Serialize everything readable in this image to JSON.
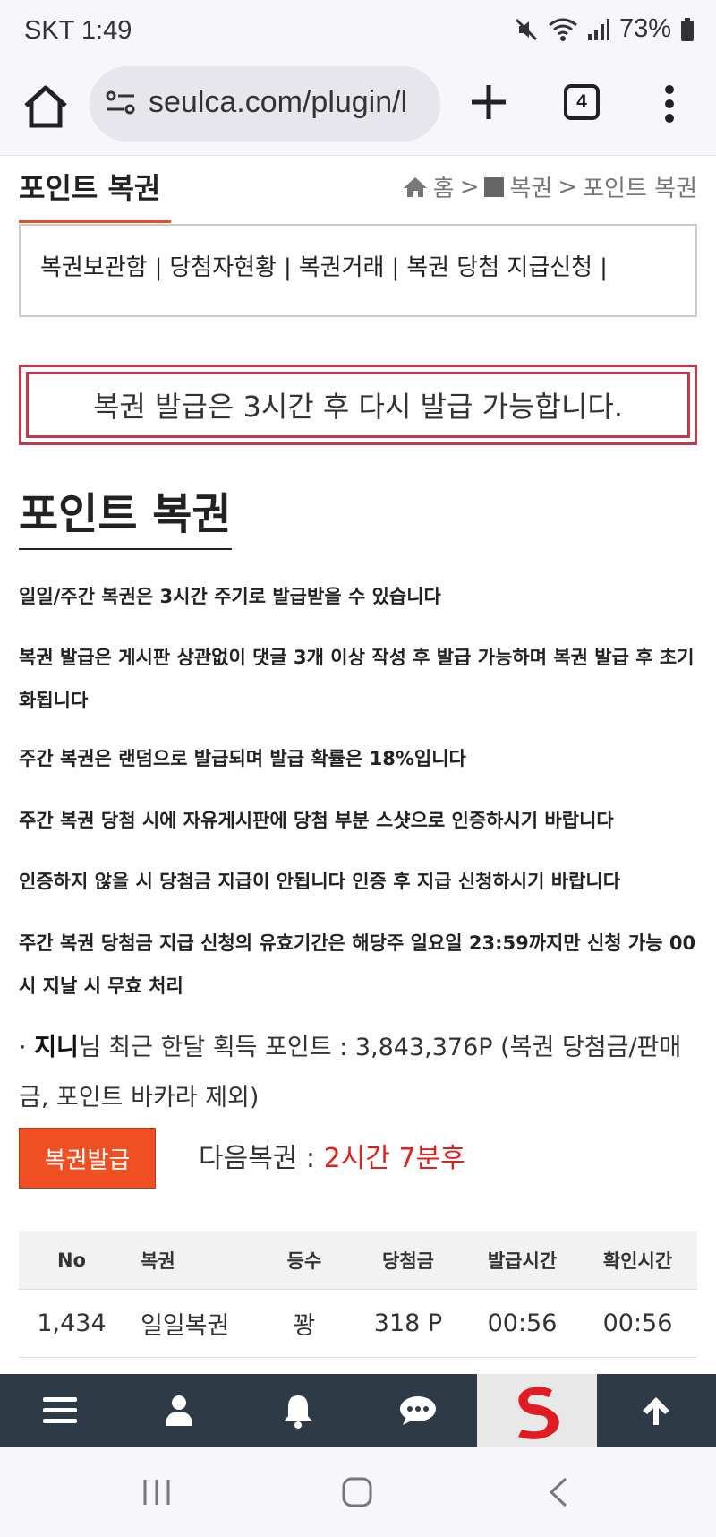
{
  "status_bar": {
    "time": "SKT 1:49",
    "battery": "73%"
  },
  "browser": {
    "url": "seulca.com/plugin/l",
    "tab_count": "4"
  },
  "page": {
    "title": "포인트 복권",
    "breadcrumb": {
      "home": "홈",
      "sep1": ">",
      "section": "복권",
      "sep2": ">",
      "current": "포인트 복권"
    },
    "menu": [
      "복권보관함",
      "당첨자현황",
      "복권거래",
      "복권 당첨 지급신청"
    ],
    "menu_sep": "|",
    "notice": "복권 발급은 3시간 후 다시 발급 가능합니다.",
    "section_title": "포인트 복권",
    "rules": [
      "일일/주간 복권은 3시간 주기로 발급받을 수 있습니다",
      "복권 발급은 게시판 상관없이 댓글 3개 이상 작성 후 발급 가능하며 복권 발급 후 초기화됩니다",
      "주간 복권은 랜덤으로 발급되며 발급 확률은 18%입니다",
      "주간 복권 당첨 시에 자유게시판에 당첨 부분 스샷으로 인증하시기 바랍니다",
      "인증하지 않을 시 당첨금 지급이 안됩니다 인증 후 지급 신청하시기 바랍니다",
      "주간 복권 당첨금 지급 신청의 유효기간은 해당주 일요일 23:59까지만 신청 가능 00시 지날 시 무효 처리"
    ],
    "points": {
      "bullet": "·",
      "user": "지니",
      "text": "님 최근 한달 획득 포인트 : 3,843,376P (복권 당첨금/판매금, 포인트 바카라 제외)"
    },
    "issue_button": "복권발급",
    "next_label": "다음복권 : ",
    "next_value": "2시간 7분후"
  },
  "table": {
    "headers": [
      "No",
      "복권",
      "등수",
      "당첨금",
      "발급시간",
      "확인시간"
    ],
    "rows": [
      [
        "1,434",
        "일일복권",
        "꽝",
        "318 P",
        "00:56",
        "00:56"
      ]
    ]
  },
  "bottom_nav": [
    "menu-icon",
    "user-icon",
    "bell-icon",
    "chat-icon",
    "site-logo",
    "arrow-up-icon"
  ],
  "colors": {
    "accent": "#f04e23",
    "notice_border": "#c7364b",
    "next_value": "#e0201c",
    "bottom_nav_bg": "#2e3a45"
  }
}
